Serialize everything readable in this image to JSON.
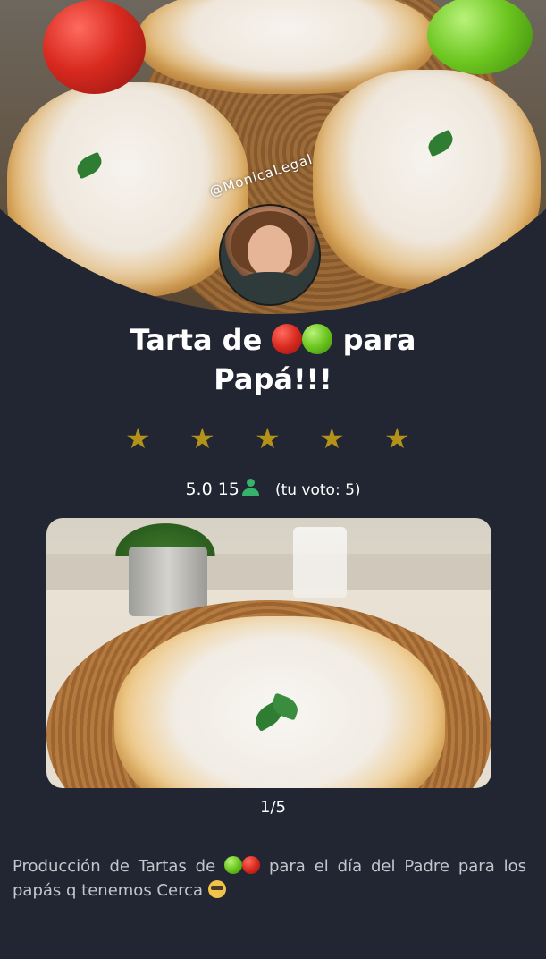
{
  "recipe": {
    "author_handle": "@MonicaLegal",
    "title_part1": "Tarta de",
    "title_part2": "para",
    "title_line2": "Papá!!!",
    "title_emojis": [
      "red-apple-icon",
      "green-apple-icon"
    ],
    "rating": {
      "stars_total": 5,
      "stars_filled": 5,
      "star_color": "#b3921a",
      "score": "5.0",
      "votes": "15",
      "your_vote": "(tu voto: 5)"
    },
    "gallery": {
      "counter": "1/5"
    },
    "description": {
      "part1": "Producción de Tartas de",
      "part2": "para el día del Padre para los papás q tenemos Cerca",
      "emojis": [
        "green-apple-icon",
        "red-apple-icon",
        "sunglasses-face-icon"
      ]
    }
  },
  "theme": {
    "background": "#222633",
    "accent_green": "#35b36b"
  }
}
